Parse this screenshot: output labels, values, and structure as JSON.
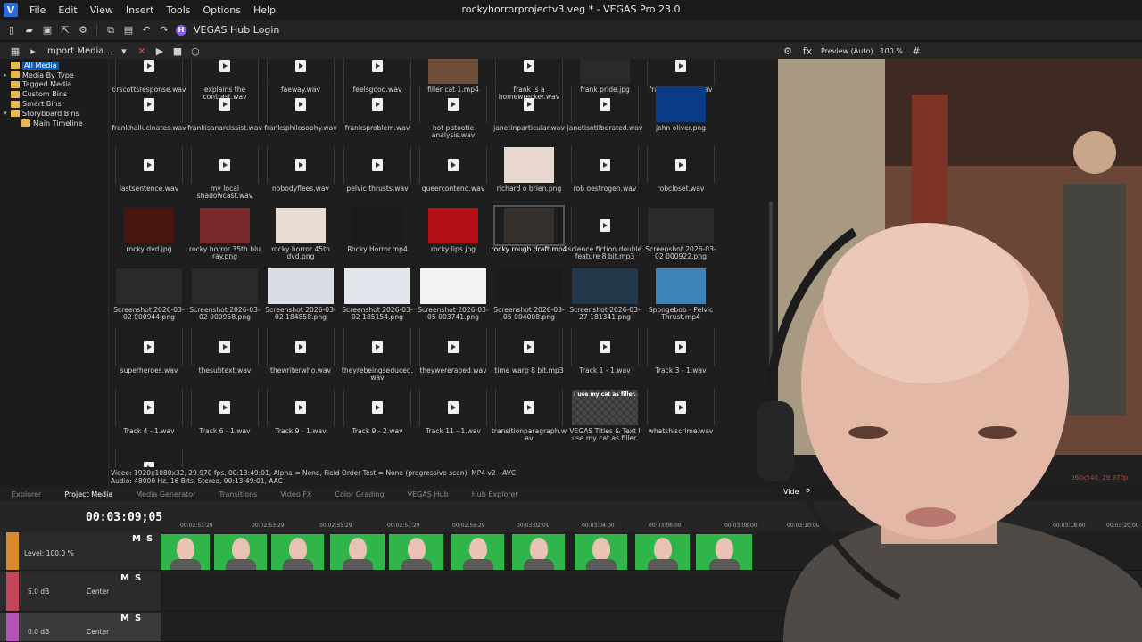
{
  "window": {
    "title": "rockyhorrorprojectv3.veg * - VEGAS Pro 23.0",
    "logo_letter": "V"
  },
  "menu": [
    "File",
    "Edit",
    "View",
    "Insert",
    "Tools",
    "Options",
    "Help"
  ],
  "toolbar": {
    "hub_label": "VEGAS Hub Login"
  },
  "media_toolbar": {
    "import_label": "Import Media..."
  },
  "tree": [
    {
      "label": "All Media",
      "selected": true,
      "arrow": ""
    },
    {
      "label": "Media By Type",
      "arrow": "▸"
    },
    {
      "label": "Tagged Media",
      "arrow": ""
    },
    {
      "label": "Custom Bins",
      "arrow": ""
    },
    {
      "label": "Smart Bins",
      "arrow": ""
    },
    {
      "label": "Storyboard Bins",
      "arrow": "▾"
    },
    {
      "label": "Main Timeline",
      "arrow": "",
      "indent": true
    }
  ],
  "media_rows": [
    [
      "drscottsresponse.wav",
      "explains the contrast.wav",
      "faeway.wav",
      "feelsgood.wav",
      "filler cat 1.mp4",
      "frank is a homewrecker.wav",
      "frank pride.jpg",
      "frankandrocky.wav"
    ],
    [
      "frankhallucinates.wav",
      "frankisanarcissist.wav",
      "franksphilosophy.wav",
      "franksproblem.wav",
      "hot patootie analysis.wav",
      "janetinparticular.wav",
      "janetisntliberated.wav",
      "john oliver.png"
    ],
    [
      "lastsentence.wav",
      "my local shadowcast.wav",
      "nobodyflees.wav",
      "pelvic thrusts.wav",
      "queercontend.wav",
      "richard o brien.png",
      "rob oestrogen.wav",
      "robcloset.wav"
    ],
    [
      "rocky dvd.jpg",
      "rocky horror 35th blu ray.png",
      "rocky horror 45th dvd.png",
      "Rocky Horror.mp4",
      "rocky lips.jpg",
      "rocky rough draft.mp4",
      "science fiction double feature 8 bit.mp3",
      "Screenshot 2026-03-02 000922.png"
    ],
    [
      "Screenshot 2026-03-02 000944.png",
      "Screenshot 2026-03-02 000958.png",
      "Screenshot 2026-03-02 184858.png",
      "Screenshot 2026-03-02 185154.png",
      "Screenshot 2026-03-05 003741.png",
      "Screenshot 2026-03-05 004008.png",
      "Screenshot 2026-03-27 181341.png",
      "Spongebob - Pelvic Thrust.mp4"
    ],
    [
      "superheroes.wav",
      "thesubtext.wav",
      "thewriterwho.wav",
      "theyrebeingseduced.wav",
      "theywereraped.wav",
      "time warp 8 bit.mp3",
      "Track 1 - 1.wav",
      "Track 3 - 1.wav"
    ],
    [
      "Track 4 - 1.wav",
      "Track 6 - 1.wav",
      "Track 9 - 1.wav",
      "Track 9 - 2.wav",
      "Track 11 - 1.wav",
      "transitionparagraph.wav",
      "VEGAS Titles & Text I use my cat as filler.",
      "whatshiscrime.wav"
    ]
  ],
  "title_card_text": "I use my cat as filler.",
  "info": {
    "video": "Video: 1920x1080x32, 29.970 fps, 00:13:49:01, Alpha = None, Field Order Test = None (progressive scan), MP4 v2 - AVC",
    "audio": "Audio: 48000 Hz, 16 Bits, Stereo, 00:13:49:01, AAC"
  },
  "tabs": [
    "Explorer",
    "Project Media",
    "Media Generator",
    "Transitions",
    "Video FX",
    "Color Grading",
    "VEGAS Hub",
    "Hub Explorer"
  ],
  "active_tab": "Project Media",
  "video_tab": "Video P",
  "preview": {
    "mode": "Preview (Auto)",
    "zoom": "100 %",
    "resolution_info": "960x540, 29.970p",
    "partial_text": "970i"
  },
  "timeline": {
    "timecode": "00:03:09;05",
    "ruler": [
      "00:02:51:28",
      "00:02:53:29",
      "00:02:55:29",
      "00:02:57:29",
      "00:02:59:29",
      "00:03:02:01",
      "00:03:04:00",
      "00:03:06:00",
      "00:03:08:00",
      "00:03:10:00",
      "00:03:18:00",
      "00:03:20:00"
    ],
    "tracks": [
      {
        "m": "M",
        "s": "S",
        "label": "Level: 100.0 %",
        "color": "#d98a2c"
      },
      {
        "m": "M",
        "s": "S",
        "label": "5.0 dB",
        "center": "Center",
        "color": "#c4455a"
      },
      {
        "m": "M",
        "s": "S",
        "label": "0.0 dB",
        "center": "Center",
        "color": "#b255b5"
      }
    ]
  },
  "colors": {
    "accent": "#0a5bb5",
    "clip_green": "#2fb54a",
    "hub": "#8b5cf6"
  }
}
